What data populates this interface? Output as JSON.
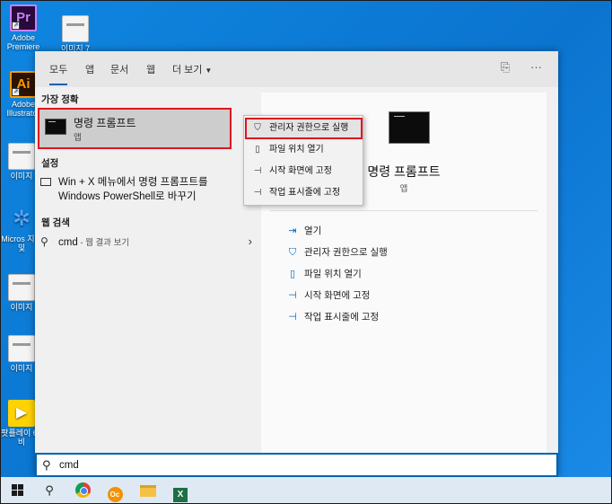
{
  "desktop": {
    "icons": [
      {
        "label": "Adobe Premiere",
        "glyph": "Pr",
        "icon": "premiere-icon"
      },
      {
        "label": "이미지 7",
        "glyph": "",
        "icon": "image-file-icon"
      },
      {
        "label": "Adobe Illustrator",
        "glyph": "Ai",
        "icon": "illustrator-icon"
      },
      {
        "label": "이미지",
        "glyph": "",
        "icon": "image-file-icon"
      },
      {
        "label": "Micros 지원 및",
        "glyph": "",
        "icon": "tools-icon"
      },
      {
        "label": "이미지",
        "glyph": "",
        "icon": "image-file-icon"
      },
      {
        "label": "이미지",
        "glyph": "",
        "icon": "image-file-icon"
      },
      {
        "label": "팟플레이 64 비",
        "glyph": "",
        "icon": "play-icon"
      }
    ]
  },
  "search_panel": {
    "tabs": [
      {
        "label": "모두",
        "active": true
      },
      {
        "label": "앱"
      },
      {
        "label": "문서"
      },
      {
        "label": "웹"
      },
      {
        "label": "더 보기",
        "caret": "▼"
      }
    ],
    "best_match": {
      "heading": "가장 정확",
      "title": "명령 프롬프트",
      "subtitle": "앱"
    },
    "settings": {
      "heading": "설정",
      "item": "Win + X 메뉴에서 명령 프롬프트를 Windows PowerShell로 바꾸기"
    },
    "web": {
      "heading": "웹 검색",
      "query": "cmd",
      "suffix": " - 웹 결과 보기"
    },
    "preview": {
      "title": "명령 프롬프트",
      "subtitle": "앱",
      "actions": [
        {
          "label": "열기",
          "icon": "open-icon"
        },
        {
          "label": "관리자 권한으로 실행",
          "icon": "shield-icon"
        },
        {
          "label": "파일 위치 열기",
          "icon": "file-location-icon"
        },
        {
          "label": "시작 화면에 고정",
          "icon": "pin-icon"
        },
        {
          "label": "작업 표시줄에 고정",
          "icon": "pin-icon"
        }
      ]
    }
  },
  "context_menu": {
    "items": [
      {
        "label": "관리자 권한으로 실행",
        "icon": "shield-icon",
        "highlighted": true
      },
      {
        "label": "파일 위치 열기",
        "icon": "file-location-icon"
      },
      {
        "label": "시작 화면에 고정",
        "icon": "pin-icon"
      },
      {
        "label": "작업 표시줄에 고정",
        "icon": "pin-icon"
      }
    ]
  },
  "search_box": {
    "value": "cmd"
  },
  "taskbar": {
    "oc_label": "Oc",
    "excel_label": "X"
  },
  "colors": {
    "accent": "#0063b1",
    "highlight_border": "#e0141e",
    "desktop_bg": "#0b74cf"
  }
}
